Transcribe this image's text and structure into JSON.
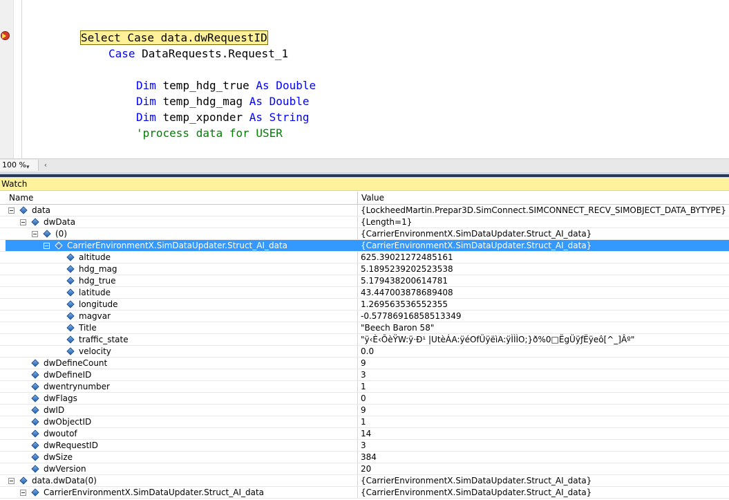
{
  "editor": {
    "lines": [
      {
        "parts": [
          {
            "t": "Select Case data.dwRequestID",
            "c": "hl"
          }
        ]
      },
      {
        "parts": [
          {
            "t": "Case",
            "c": "kw"
          },
          {
            "t": " DataRequests.Request_1",
            "c": ""
          }
        ]
      },
      {
        "parts": [
          {
            "t": "Dim",
            "c": "kw"
          },
          {
            "t": " temp_hdg_true ",
            "c": ""
          },
          {
            "t": "As Double",
            "c": "kw"
          }
        ]
      },
      {
        "parts": [
          {
            "t": "Dim",
            "c": "kw"
          },
          {
            "t": " temp_hdg_mag ",
            "c": ""
          },
          {
            "t": "As Double",
            "c": "kw"
          }
        ]
      },
      {
        "parts": [
          {
            "t": "Dim",
            "c": "kw"
          },
          {
            "t": " temp_xponder ",
            "c": ""
          },
          {
            "t": "As String",
            "c": "kw"
          }
        ]
      },
      {
        "parts": [
          {
            "t": "'process data for USER",
            "c": "cm"
          }
        ]
      }
    ]
  },
  "status": {
    "zoom": "100 %",
    "scroll_left_glyph": "‹"
  },
  "watch": {
    "title": "Watch",
    "columns": {
      "name": "Name",
      "value": "Value"
    },
    "rows": [
      {
        "name": "data",
        "value": "{LockheedMartin.Prepar3D.SimConnect.SIMCONNECT_RECV_SIMOBJECT_DATA_BYTYPE}",
        "depth": 0,
        "expanded": true,
        "selected": false
      },
      {
        "name": "dwData",
        "value": "{Length=1}",
        "depth": 1,
        "expanded": true,
        "selected": false
      },
      {
        "name": "(0)",
        "value": "{CarrierEnvironmentX.SimDataUpdater.Struct_AI_data}",
        "depth": 2,
        "expanded": true,
        "selected": false
      },
      {
        "name": "CarrierEnvironmentX.SimDataUpdater.Struct_AI_data",
        "value": "{CarrierEnvironmentX.SimDataUpdater.Struct_AI_data}",
        "depth": 3,
        "expanded": true,
        "selected": true
      },
      {
        "name": "altitude",
        "value": "625.39021272485161",
        "depth": 4,
        "expanded": null,
        "selected": false
      },
      {
        "name": "hdg_mag",
        "value": "5.1895239202523538",
        "depth": 4,
        "expanded": null,
        "selected": false
      },
      {
        "name": "hdg_true",
        "value": "5.179438200614781",
        "depth": 4,
        "expanded": null,
        "selected": false
      },
      {
        "name": "latitude",
        "value": "43.447003878689408",
        "depth": 4,
        "expanded": null,
        "selected": false
      },
      {
        "name": "longitude",
        "value": "1.269563536552355",
        "depth": 4,
        "expanded": null,
        "selected": false
      },
      {
        "name": "magvar",
        "value": "-0.57786916858513349",
        "depth": 4,
        "expanded": null,
        "selected": false
      },
      {
        "name": "Title",
        "value": "\"Beech Baron 58\"",
        "depth": 4,
        "expanded": null,
        "selected": false
      },
      {
        "name": "traffic_state",
        "value": "\"ÿ‹È‹ÕèŸW:ÿ·Ð¹ |UtèÁA:ÿéOfÜÿëìA:ÿÌÌÌO;}ð%0□ËgÜÿƒËÿeô[^_]Âº\"",
        "depth": 4,
        "expanded": null,
        "selected": false
      },
      {
        "name": "velocity",
        "value": "0.0",
        "depth": 4,
        "expanded": null,
        "selected": false
      },
      {
        "name": "dwDefineCount",
        "value": "9",
        "depth": 1,
        "expanded": null,
        "selected": false
      },
      {
        "name": "dwDefineID",
        "value": "3",
        "depth": 1,
        "expanded": null,
        "selected": false
      },
      {
        "name": "dwentrynumber",
        "value": "1",
        "depth": 1,
        "expanded": null,
        "selected": false
      },
      {
        "name": "dwFlags",
        "value": "0",
        "depth": 1,
        "expanded": null,
        "selected": false
      },
      {
        "name": "dwID",
        "value": "9",
        "depth": 1,
        "expanded": null,
        "selected": false
      },
      {
        "name": "dwObjectID",
        "value": "1",
        "depth": 1,
        "expanded": null,
        "selected": false
      },
      {
        "name": "dwoutof",
        "value": "14",
        "depth": 1,
        "expanded": null,
        "selected": false
      },
      {
        "name": "dwRequestID",
        "value": "3",
        "depth": 1,
        "expanded": null,
        "selected": false
      },
      {
        "name": "dwSize",
        "value": "384",
        "depth": 1,
        "expanded": null,
        "selected": false
      },
      {
        "name": "dwVersion",
        "value": "20",
        "depth": 1,
        "expanded": null,
        "selected": false
      },
      {
        "name": "data.dwData(0)",
        "value": "{CarrierEnvironmentX.SimDataUpdater.Struct_AI_data}",
        "depth": 0,
        "expanded": true,
        "selected": false
      },
      {
        "name": "CarrierEnvironmentX.SimDataUpdater.Struct_AI_data",
        "value": "{CarrierEnvironmentX.SimDataUpdater.Struct_AI_data}",
        "depth": 1,
        "expanded": true,
        "selected": false
      }
    ]
  }
}
